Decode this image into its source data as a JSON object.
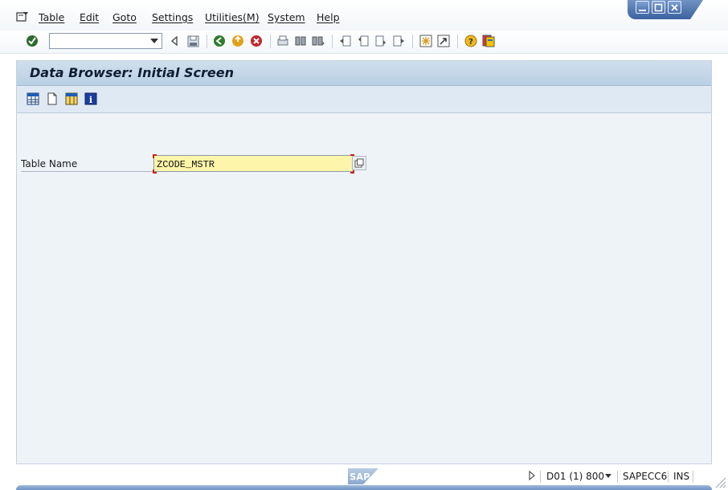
{
  "menu": {
    "items": [
      "Table",
      "Edit",
      "Goto",
      "Settings",
      "Utilities(M)",
      "System",
      "Help"
    ]
  },
  "toolbar": {
    "command_value": "",
    "icons": [
      "enter-icon",
      "back-icon",
      "save-icon",
      "green-back-icon",
      "exit-icon",
      "cancel-icon",
      "print-icon",
      "find-icon",
      "find-next-icon",
      "first-page-icon",
      "previous-page-icon",
      "next-page-icon",
      "last-page-icon",
      "create-session-icon",
      "shortcut-icon",
      "help-icon",
      "customize-layout-icon"
    ]
  },
  "page": {
    "title": "Data Browser: Initial Screen"
  },
  "app_toolbar": {
    "icons": [
      "table-contents-icon",
      "new-entries-icon",
      "table-view-icon",
      "info-icon"
    ]
  },
  "form": {
    "table_name_label": "Table Name",
    "table_name_value": "ZCODE_MSTR"
  },
  "status": {
    "logo_text": "SAP",
    "system": "D01 (1) 800",
    "server": "SAPECC6",
    "mode": "INS"
  },
  "colors": {
    "title_bar": "#c4d7ea",
    "required_field": "#fdf5a9",
    "window_controls": "#4a6faa"
  }
}
